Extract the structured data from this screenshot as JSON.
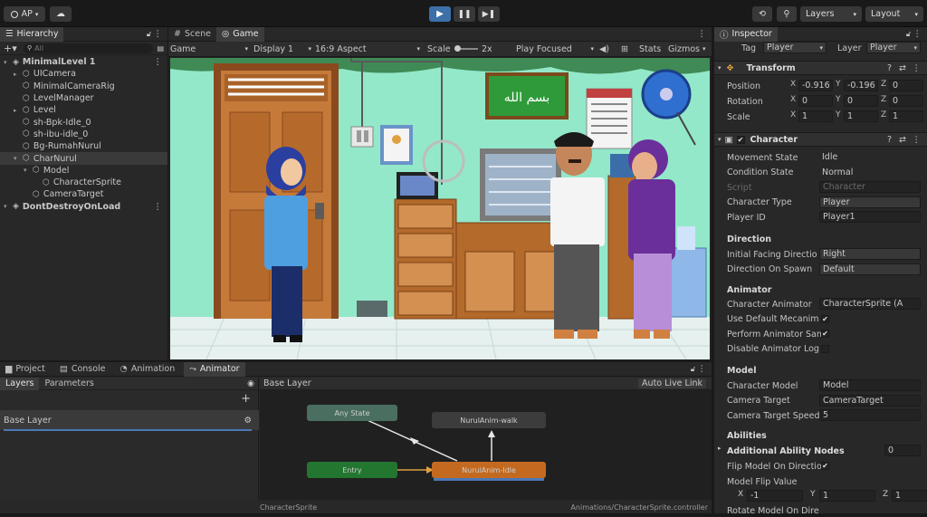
{
  "toolbar": {
    "account": "AP",
    "layers": "Layers",
    "layout": "Layout"
  },
  "hierarchy": {
    "tab": "Hierarchy",
    "search_placeholder": "All",
    "items": [
      {
        "label": "MinimalLevel 1",
        "indent": 0,
        "icon": "scene-icon"
      },
      {
        "label": "UICamera",
        "indent": 1,
        "icon": "cube-icon"
      },
      {
        "label": "MinimalCameraRig",
        "indent": 1,
        "icon": "cube-icon"
      },
      {
        "label": "LevelManager",
        "indent": 1,
        "icon": "cube-icon"
      },
      {
        "label": "Level",
        "indent": 1,
        "icon": "cube-icon"
      },
      {
        "label": "sh-Bpk-Idle_0",
        "indent": 1,
        "icon": "cube-icon"
      },
      {
        "label": "sh-ibu-idle_0",
        "indent": 1,
        "icon": "cube-icon"
      },
      {
        "label": "Bg-RumahNurul",
        "indent": 1,
        "icon": "cube-icon"
      },
      {
        "label": "CharNurul",
        "indent": 1,
        "icon": "cube-icon"
      },
      {
        "label": "Model",
        "indent": 2,
        "icon": "cube-icon"
      },
      {
        "label": "CharacterSprite",
        "indent": 3,
        "icon": "cube-icon"
      },
      {
        "label": "CameraTarget",
        "indent": 2,
        "icon": "cube-icon"
      },
      {
        "label": "DontDestroyOnLoad",
        "indent": 0,
        "icon": "scene-icon"
      }
    ]
  },
  "scene": {
    "tabs": [
      "Scene",
      "Game"
    ],
    "game_dropdown": "Game",
    "display": "Display 1",
    "aspect": "16:9 Aspect",
    "scale_label": "Scale",
    "scale_value": "2x",
    "play_mode": "Play Focused",
    "stats": "Stats",
    "gizmos": "Gizmos"
  },
  "bottom": {
    "tabs": [
      "Project",
      "Console",
      "Animation",
      "Animator"
    ],
    "subtabs": [
      "Layers",
      "Parameters"
    ],
    "layer_name": "Base Layer",
    "breadcrumb": "Base Layer",
    "live_link": "Auto Live Link",
    "nodes": {
      "any_state": "Any State",
      "walk": "NurulAnim-walk",
      "entry": "Entry",
      "idle": "NurulAnim-Idle"
    },
    "footer_left": "CharacterSprite",
    "footer_right": "Animations/CharacterSprite.controller"
  },
  "inspector": {
    "tab": "Inspector",
    "tag_label": "Tag",
    "tag_value": "Player",
    "layer_label": "Layer",
    "layer_value": "Player",
    "transform": {
      "title": "Transform",
      "position_label": "Position",
      "rotation_label": "Rotation",
      "scale_label": "Scale",
      "position": [
        "-0.916",
        "-0.196",
        "0"
      ],
      "rotation": [
        "0",
        "0",
        "0"
      ],
      "scale": [
        "1",
        "1",
        "1"
      ]
    },
    "character": {
      "title": "Character",
      "fields": [
        {
          "label": "Movement State",
          "value": "Idle"
        },
        {
          "label": "Condition State",
          "value": "Normal"
        },
        {
          "label": "Script",
          "value": "Character"
        },
        {
          "label": "Character Type",
          "value": "Player"
        },
        {
          "label": "Player ID",
          "value": "Player1"
        }
      ],
      "direction_header": "Direction",
      "direction": [
        {
          "label": "Initial Facing Directio",
          "value": "Right"
        },
        {
          "label": "Direction On Spawn",
          "value": "Default"
        }
      ],
      "animator_header": "Animator",
      "animator": [
        {
          "label": "Character Animator",
          "value": "CharacterSprite (A"
        },
        {
          "label": "Use Default Mecanim",
          "value": "✔"
        },
        {
          "label": "Perform Animator San",
          "value": "✔"
        },
        {
          "label": "Disable Animator Log",
          "value": ""
        }
      ],
      "model_header": "Model",
      "model": [
        {
          "label": "Character Model",
          "value": "Model"
        },
        {
          "label": "Camera Target",
          "value": "CameraTarget"
        },
        {
          "label": "Camera Target Speed",
          "value": "5"
        }
      ],
      "abilities_header": "Abilities",
      "additional_nodes_label": "Additional Ability Nodes",
      "additional_nodes_value": "0",
      "flip_label": "Flip Model On Directio",
      "flip_value": "✔",
      "flip_value_label": "Model Flip Value",
      "flip_xyz": [
        "-1",
        "1",
        "1"
      ],
      "rotate_label": "Rotate Model On Dire"
    }
  },
  "game": {
    "calligraphy": "بسم الله"
  }
}
